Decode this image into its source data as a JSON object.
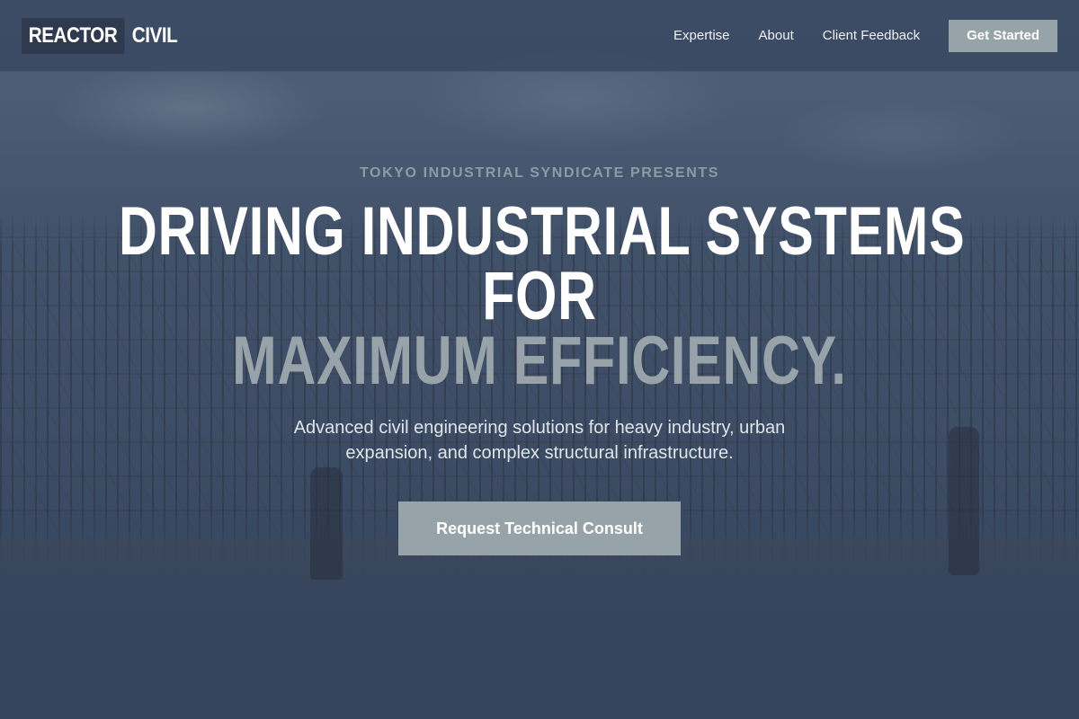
{
  "brand": {
    "logo_primary": "REACTOR",
    "logo_secondary": "CIVIL"
  },
  "nav": {
    "items": [
      {
        "label": "Expertise"
      },
      {
        "label": "About"
      },
      {
        "label": "Client Feedback"
      }
    ],
    "cta_label": "Get Started"
  },
  "hero": {
    "eyebrow": "TOKYO INDUSTRIAL SYNDICATE PRESENTS",
    "headline_line1": "DRIVING INDUSTRIAL SYSTEMS",
    "headline_line2": "FOR",
    "headline_line3": "MAXIMUM EFFICIENCY.",
    "subtext": "Advanced civil engineering solutions for heavy industry, urban expansion, and complex structural infrastructure.",
    "cta_label": "Request Technical Consult"
  },
  "colors": {
    "header_bg": "#3a4962",
    "accent_button": "#96a3a8",
    "logo_box": "#2f3a4f",
    "headline_white": "#ffffff",
    "headline_muted": "#97a3a8",
    "eyebrow": "#8e9aa6"
  }
}
